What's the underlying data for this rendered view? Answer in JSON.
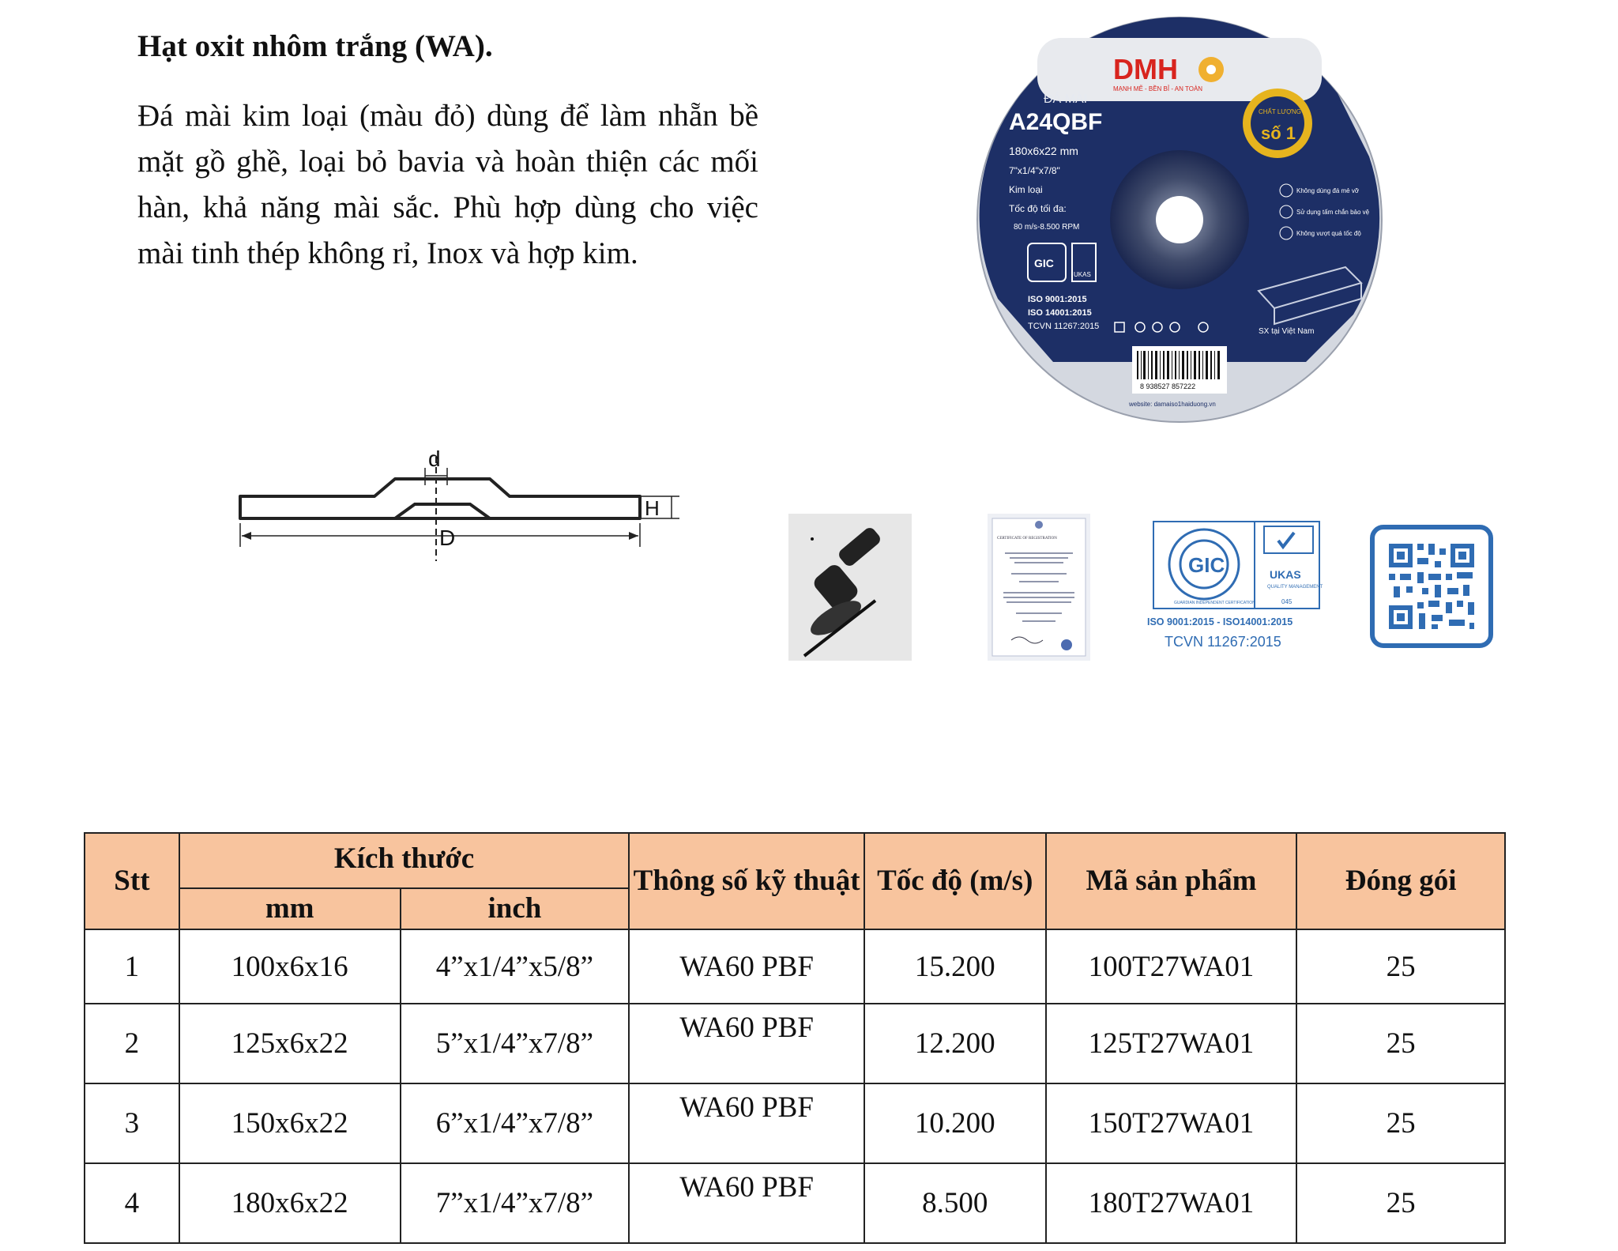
{
  "heading": "Hạt oxit nhôm trắng (WA).",
  "description": "Đá mài kim loại (màu đỏ) dùng để làm nhẵn bề mặt gồ ghề, loại bỏ bavia và hoàn thiện các mối hàn, khả năng mài sắc. Phù hợp dùng cho việc mài tinh thép không rỉ, Inox và hợp kim.",
  "disc": {
    "brand": "DMH",
    "brand_tagline": "MẠNH MẼ - BỀN BỈ - AN TOÀN",
    "type_label": "ĐÁ MÀI",
    "model": "A24QBF",
    "specs": [
      "180x6x22 mm",
      "7\"x1/4\"x7/8\"",
      "Kim loại",
      "Tốc độ tối đa:",
      "80 m/s-8.500 RPM"
    ],
    "badge_top": "CHẤT LƯỢNG",
    "badge_main": "số 1",
    "warnings": [
      "Không dùng đá mẻ vỡ",
      "Sử dụng tấm chắn bảo vệ",
      "Không vượt quá tốc độ"
    ],
    "certs": [
      "ISO 9001:2015",
      "ISO 14001:2015",
      "TCVN 11267:2015"
    ],
    "made_in": "SX tại Việt Nam",
    "barcode": "8 938527 857222",
    "website": "website: damaiso1haiduong.vn",
    "colors": {
      "disc_blue": "#1d2f66",
      "ring": "#cfd3dc",
      "brand_red": "#d8241e",
      "badge_gold": "#e6b41e"
    }
  },
  "diagram": {
    "label_d": "d",
    "label_D": "D",
    "label_H": "H"
  },
  "icons": {
    "certificate_title": "CERTIFICATE OF REGISTRATION",
    "cert_gic": "GIC",
    "cert_ukas": "UKAS",
    "cert_ukas_sub": "QUALITY MANAGEMENT",
    "cert_ukas_num": "045",
    "cert_ring_text": "GUARDIAN INDEPENDENT CERTIFICATION",
    "cert_line1": "ISO 9001:2015 - ISO14001:2015",
    "cert_line2": "TCVN 11267:2015",
    "accent_blue": "#2f6cb3"
  },
  "table": {
    "headers": {
      "stt": "Stt",
      "size": "Kích thước",
      "mm": "mm",
      "inch": "inch",
      "spec": "Thông số kỹ thuật",
      "speed": "Tốc độ (m/s)",
      "code": "Mã sản phẩm",
      "pack": "Đóng gói"
    },
    "header_color": "#f8c49e",
    "rows": [
      {
        "stt": "1",
        "mm": "100x6x16",
        "inch": "4”x1/4”x5/8”",
        "spec": "WA60 PBF",
        "speed": "15.200",
        "code": "100T27WA01",
        "pack": "25"
      },
      {
        "stt": "2",
        "mm": "125x6x22",
        "inch": "5”x1/4”x7/8”",
        "spec": "WA60 PBF",
        "speed": "12.200",
        "code": "125T27WA01",
        "pack": "25"
      },
      {
        "stt": "3",
        "mm": "150x6x22",
        "inch": "6”x1/4”x7/8”",
        "spec": "WA60 PBF",
        "speed": "10.200",
        "code": "150T27WA01",
        "pack": "25"
      },
      {
        "stt": "4",
        "mm": "180x6x22",
        "inch": "7”x1/4”x7/8”",
        "spec": "WA60 PBF",
        "speed": "8.500",
        "code": "180T27WA01",
        "pack": "25"
      }
    ]
  }
}
